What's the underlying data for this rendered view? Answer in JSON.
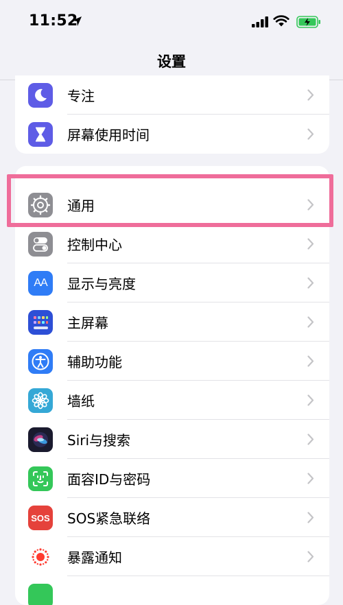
{
  "status_bar": {
    "time": "11:52"
  },
  "nav": {
    "title": "设置"
  },
  "top_group": [
    {
      "label": "专注",
      "icon": "moon-icon",
      "color": "#5e5ce6"
    },
    {
      "label": "屏幕使用时间",
      "icon": "hourglass-icon",
      "color": "#5e5ce6"
    }
  ],
  "main_group": [
    {
      "label": "通用",
      "icon": "gear-icon",
      "color": "#8e8e93"
    },
    {
      "label": "控制中心",
      "icon": "toggles-icon",
      "color": "#8e8e93"
    },
    {
      "label": "显示与亮度",
      "icon": "text-size-icon",
      "color": "#2f7cf6",
      "glyph": "AA"
    },
    {
      "label": "主屏幕",
      "icon": "home-grid-icon",
      "color": "#2d4fd6"
    },
    {
      "label": "辅助功能",
      "icon": "accessibility-icon",
      "color": "#2f7cf6"
    },
    {
      "label": "墙纸",
      "icon": "flower-icon",
      "color": "#35a8d6"
    },
    {
      "label": "Siri与搜索",
      "icon": "siri-icon",
      "color": "#1a1a2e"
    },
    {
      "label": "面容ID与密码",
      "icon": "face-id-icon",
      "color": "#34c759"
    },
    {
      "label": "SOS紧急联络",
      "icon": "sos-icon",
      "color": "#e5423b",
      "glyph": "SOS"
    },
    {
      "label": "暴露通知",
      "icon": "exposure-icon",
      "color": "#ffffff"
    }
  ],
  "highlight_color": "#ef6d9a"
}
